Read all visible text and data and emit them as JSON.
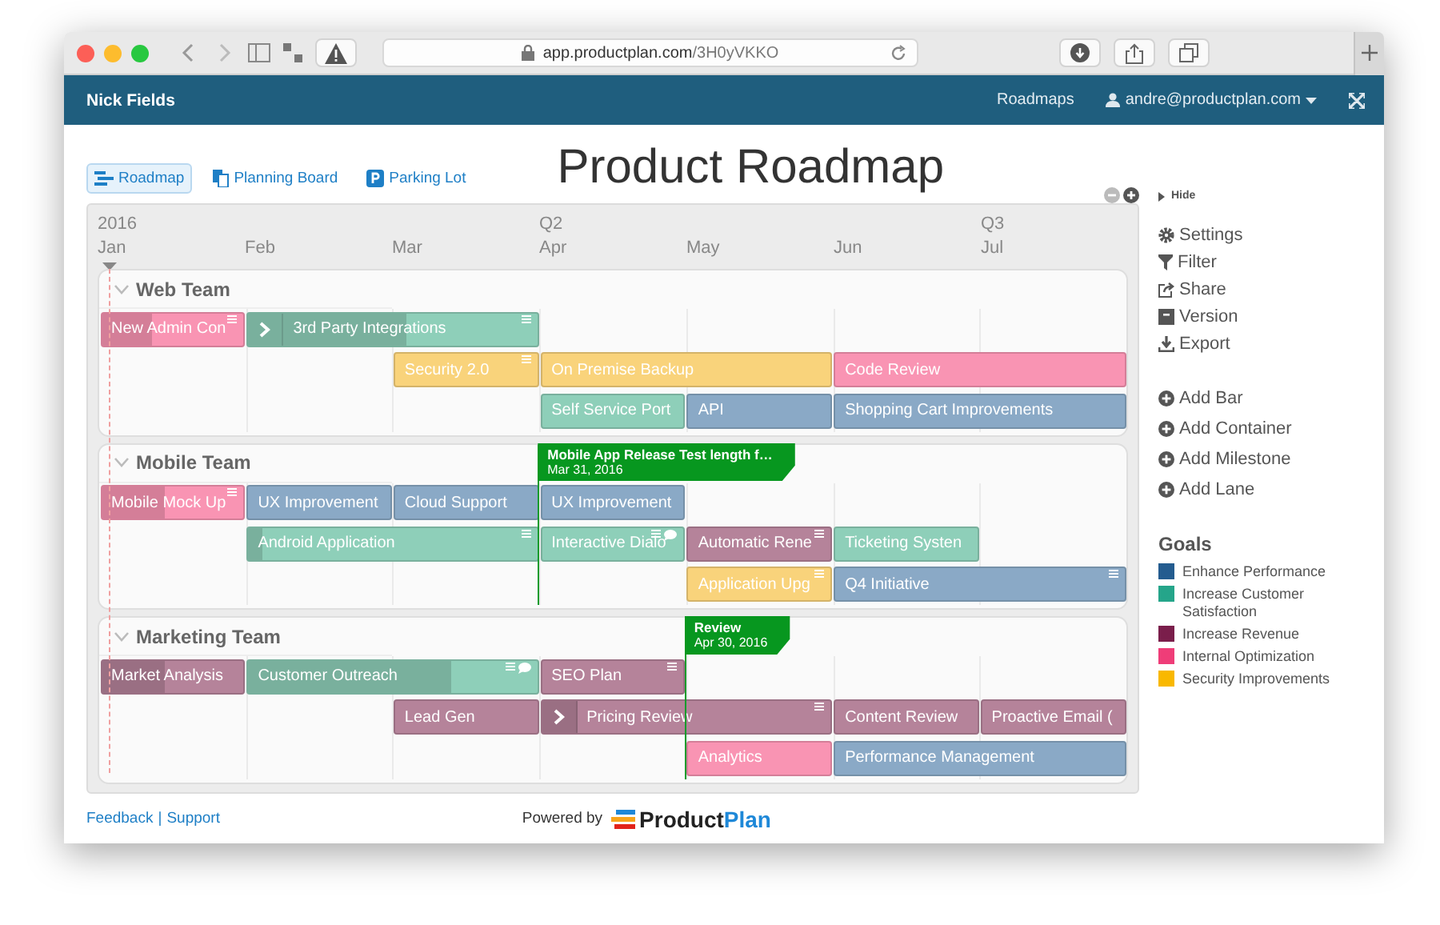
{
  "browser": {
    "url_host": "app.productplan.com",
    "url_path": "/3H0yVKKO"
  },
  "header": {
    "user": "Nick Fields",
    "nav": "Roadmaps",
    "account": "andre@productplan.com"
  },
  "tabs": [
    {
      "label": "Roadmap",
      "selected": true,
      "kind": "roadmap"
    },
    {
      "label": "Planning Board",
      "selected": false,
      "kind": "board"
    },
    {
      "label": "Parking Lot",
      "selected": false,
      "kind": "lot"
    }
  ],
  "title": "Product Roadmap",
  "timeline": {
    "months": [
      {
        "label": "Jan",
        "period": "2016"
      },
      {
        "label": "Feb"
      },
      {
        "label": "Mar"
      },
      {
        "label": "Apr",
        "period": "Q2"
      },
      {
        "label": "May"
      },
      {
        "label": "Jun"
      },
      {
        "label": "Jul",
        "period": "Q3"
      }
    ]
  },
  "lanes": [
    {
      "name": "Web Team",
      "expanded": true,
      "tracks": [
        {
          "bars": [
            {
              "label": "New Admin Con",
              "color": "#f994b3",
              "level": 0.35,
              "notes": true
            },
            {
              "label": "3rd Party Integrations",
              "color": "#8ecfb9",
              "level": 0.55,
              "children": true,
              "notes": true
            }
          ]
        },
        {
          "bars": [
            {
              "label": "Security 2.0",
              "color": "#f9d37b",
              "notes": true
            },
            {
              "label": "On Premise Backup",
              "color": "#f9d37b"
            },
            {
              "label": "Code Review",
              "color": "#f994b3"
            }
          ]
        },
        {
          "bars": [
            {
              "label": "Self Service Port",
              "color": "#8ecfb9"
            },
            {
              "label": "API",
              "color": "#8aa9c6"
            },
            {
              "label": "Shopping Cart Improvements",
              "color": "#8aa9c6"
            }
          ]
        }
      ]
    },
    {
      "name": "Mobile Team",
      "expanded": true,
      "milestone": {
        "title": "Mobile App Release Test length f…",
        "date": "Mar 31, 2016"
      },
      "tracks": [
        {
          "bars": [
            {
              "label": "Mobile Mock Up",
              "color": "#f994b3",
              "level": 0.45,
              "notes": true
            },
            {
              "label": "UX Improvement",
              "color": "#8aa9c6"
            },
            {
              "label": "Cloud Support",
              "color": "#8aa9c6"
            },
            {
              "label": "UX Improvement",
              "color": "#8aa9c6"
            }
          ]
        },
        {
          "bars": [
            {
              "label": "Android Application",
              "color": "#8ecfb9",
              "level": 0.05,
              "notes": true
            },
            {
              "label": "Interactive Dialo",
              "color": "#8ecfb9",
              "notes": true,
              "comment": true
            },
            {
              "label": "Automatic Rene",
              "color": "#b5839a",
              "notes": true
            },
            {
              "label": "Ticketing Systen",
              "color": "#8ecfb9"
            }
          ]
        },
        {
          "bars": [
            {
              "label": "Application Upg",
              "color": "#f9d37b",
              "notes": true
            },
            {
              "label": "Q4 Initiative",
              "color": "#8aa9c6",
              "notes": true
            }
          ]
        }
      ]
    },
    {
      "name": "Marketing Team",
      "expanded": true,
      "milestone": {
        "title": "Review",
        "date": "Apr 30, 2016"
      },
      "tracks": [
        {
          "bars": [
            {
              "label": "Market Analysis",
              "color": "#b5839a",
              "level": 0.45
            },
            {
              "label": "Customer Outreach",
              "color": "#8ecfb9",
              "level": 0.7,
              "notes": true,
              "comment": true
            },
            {
              "label": "SEO Plan",
              "color": "#b5839a",
              "notes": true
            }
          ]
        },
        {
          "bars": [
            {
              "label": "Lead Gen",
              "color": "#b5839a"
            },
            {
              "label": "Pricing Review",
              "color": "#b5839a",
              "children": true,
              "notes": true
            },
            {
              "label": "Content Review",
              "color": "#b5839a"
            },
            {
              "label": "Proactive Email (",
              "color": "#b5839a"
            }
          ]
        },
        {
          "bars": [
            {
              "label": "Analytics",
              "color": "#f994b3"
            },
            {
              "label": "Performance Management",
              "color": "#8aa9c6"
            }
          ]
        }
      ]
    }
  ],
  "sidebar": {
    "hide": "Hide",
    "actions": [
      {
        "label": "Settings",
        "kind": "settings"
      },
      {
        "label": "Filter",
        "kind": "filter"
      },
      {
        "label": "Share",
        "kind": "share"
      },
      {
        "label": "Version",
        "kind": "version"
      },
      {
        "label": "Export",
        "kind": "export"
      }
    ],
    "add": [
      {
        "label": "Add Bar"
      },
      {
        "label": "Add Container"
      },
      {
        "label": "Add Milestone"
      },
      {
        "label": "Add Lane"
      }
    ],
    "goals_title": "Goals",
    "goals": [
      {
        "label": "Enhance Performance",
        "color": "#245c8f"
      },
      {
        "label": "Increase Customer Satisfaction",
        "color": "#25a58a"
      },
      {
        "label": "Increase Revenue",
        "color": "#7a1e4b"
      },
      {
        "label": "Internal Optimization",
        "color": "#ef3d78"
      },
      {
        "label": "Security Improvements",
        "color": "#f9b800"
      }
    ]
  },
  "footer": {
    "links": [
      "Feedback",
      "Support"
    ],
    "separator": "|",
    "powered": "Powered by",
    "brand": [
      "Product",
      "Plan"
    ]
  }
}
